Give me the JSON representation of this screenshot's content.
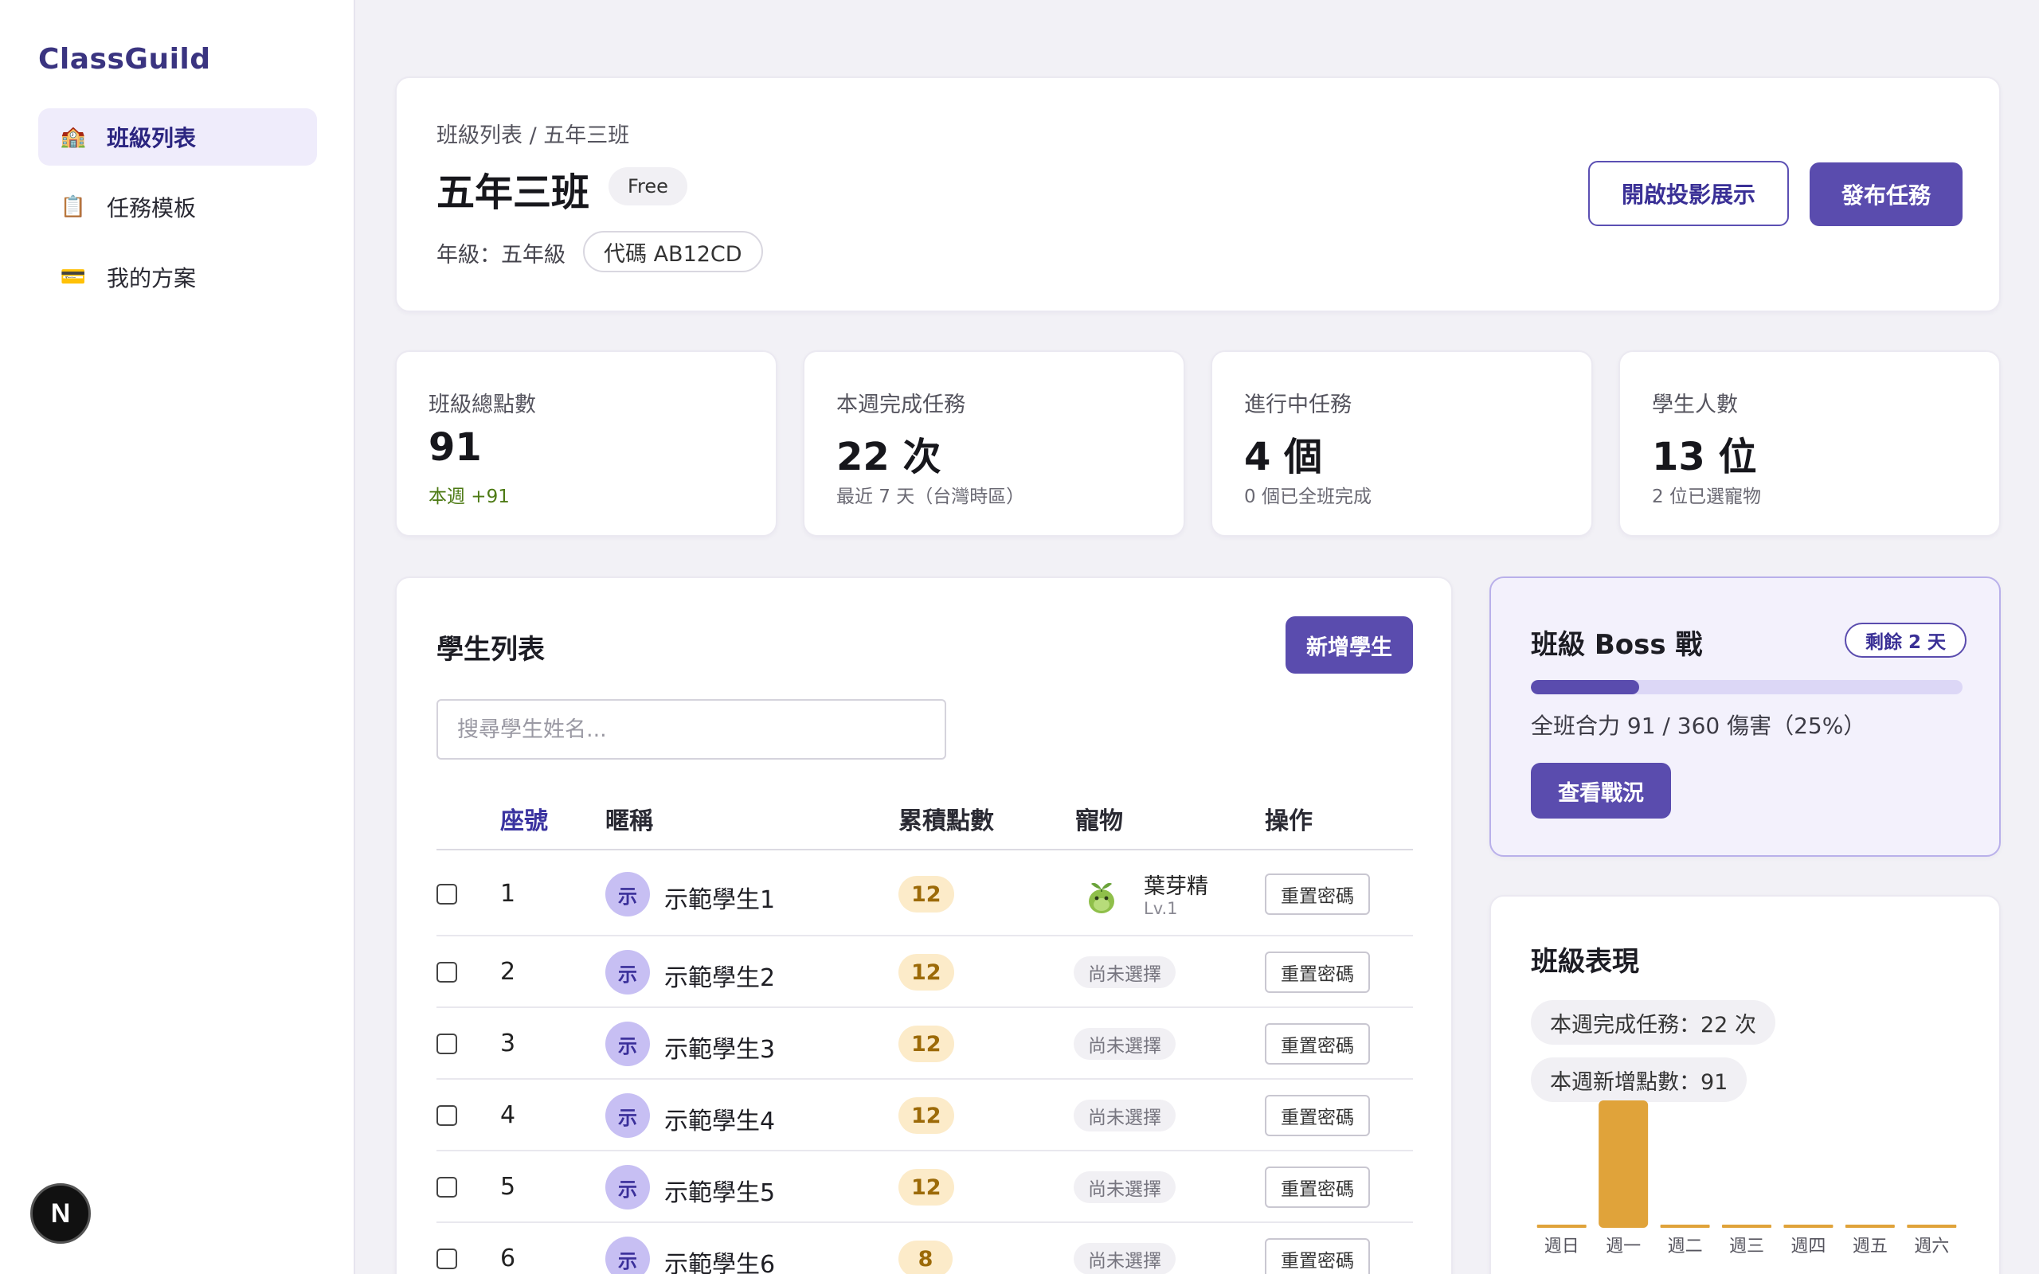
{
  "sidebar": {
    "brand": "ClassGuild",
    "items": [
      {
        "label": "班級列表",
        "icon": "school-icon",
        "glyph": "🏫",
        "active": true
      },
      {
        "label": "任務模板",
        "icon": "clipboard-icon",
        "glyph": "📋",
        "active": false
      },
      {
        "label": "我的方案",
        "icon": "credit-card-icon",
        "glyph": "💳",
        "active": false
      }
    ],
    "dev_badge": "N"
  },
  "header": {
    "breadcrumb": "班級列表 / 五年三班",
    "title": "五年三班",
    "plan_badge": "Free",
    "grade": "年級：五年級",
    "code": "代碼 AB12CD",
    "projection_button": "開啟投影展示",
    "publish_button": "發布任務"
  },
  "stats": [
    {
      "label": "班級總點數",
      "value": "91",
      "sub": "本週 +91",
      "sub_color": "#4d7a14"
    },
    {
      "label": "本週完成任務",
      "value": "22 次",
      "sub": "最近 7 天（台灣時區）"
    },
    {
      "label": "進行中任務",
      "value": "4 個",
      "sub": "0 個已全班完成"
    },
    {
      "label": "學生人數",
      "value": "13 位",
      "sub": "2 位已選寵物"
    }
  ],
  "students": {
    "title": "學生列表",
    "add_button": "新增學生",
    "search_placeholder": "搜尋學生姓名...",
    "columns": {
      "seat": "座號",
      "nickname": "暱稱",
      "points": "累積點數",
      "pet": "寵物",
      "actions": "操作"
    },
    "sorted_column": "seat",
    "reset_label": "重置密碼",
    "no_pet_label": "尚未選擇",
    "rows": [
      {
        "seat": "1",
        "avatar": "示",
        "name": "示範學生1",
        "points": "12",
        "pet": {
          "name": "葉芽精",
          "level": "Lv.1"
        }
      },
      {
        "seat": "2",
        "avatar": "示",
        "name": "示範學生2",
        "points": "12",
        "pet": null
      },
      {
        "seat": "3",
        "avatar": "示",
        "name": "示範學生3",
        "points": "12",
        "pet": null
      },
      {
        "seat": "4",
        "avatar": "示",
        "name": "示範學生4",
        "points": "12",
        "pet": null
      },
      {
        "seat": "5",
        "avatar": "示",
        "name": "示範學生5",
        "points": "12",
        "pet": null
      },
      {
        "seat": "6",
        "avatar": "示",
        "name": "示範學生6",
        "points": "8",
        "pet": null
      }
    ]
  },
  "boss": {
    "title": "班級 Boss 戰",
    "remaining": "剩餘 2 天",
    "progress": 0.25,
    "damage_text": "全班合力 91 / 360 傷害（25%）",
    "view_button": "查看戰況"
  },
  "performance": {
    "title": "班級表現",
    "weekly_tasks": "本週完成任務：22 次",
    "weekly_points": "本週新增點數：91",
    "chart_data": {
      "type": "bar",
      "categories": [
        "週日",
        "週一",
        "週二",
        "週三",
        "週四",
        "週五",
        "週六"
      ],
      "values": [
        0,
        91,
        0,
        0,
        0,
        0,
        0
      ],
      "bar_color": "#e0a33a"
    }
  },
  "colors": {
    "accent": "#5a4cae",
    "points_bg": "#fcebc9",
    "avatar_bg": "#c7bff3"
  }
}
